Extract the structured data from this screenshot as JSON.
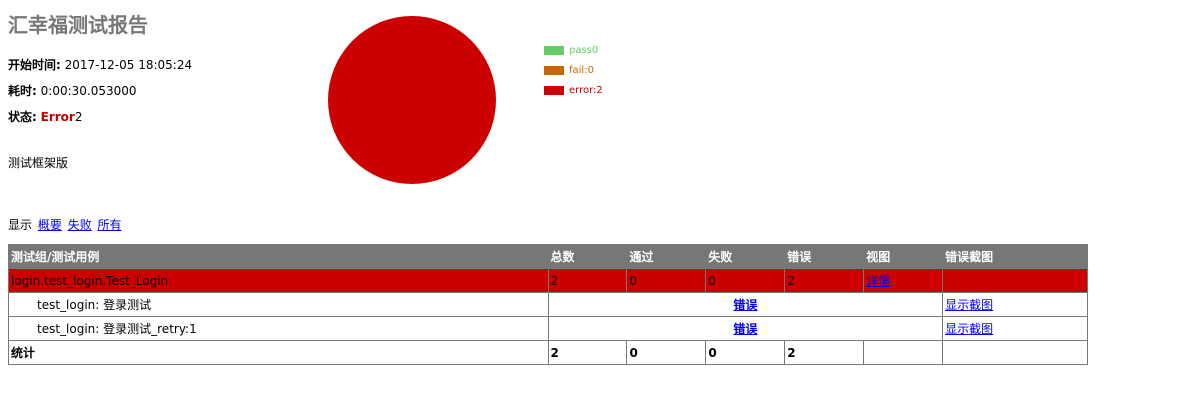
{
  "report": {
    "title": "汇幸福测试报告",
    "start_label": "开始时间:",
    "start_value": "2017-12-05 18:05:24",
    "duration_label": "耗时:",
    "duration_value": "0:00:30.053000",
    "status_label": "状态:",
    "status_value": "Error",
    "status_count": "2",
    "description": "测试框架版"
  },
  "chart_data": {
    "type": "pie",
    "slices": [
      {
        "name": "pass",
        "value": 0,
        "color": "#66cc66"
      },
      {
        "name": "fail",
        "value": 0,
        "color": "#cc6600"
      },
      {
        "name": "error",
        "value": 2,
        "color": "#cc0000"
      }
    ],
    "legend": [
      "pass0",
      "fail:0",
      "error:2"
    ],
    "legend_placement": "right"
  },
  "filter": {
    "label": "显示",
    "links": [
      "概要",
      "失败",
      "所有"
    ]
  },
  "table": {
    "headers": [
      "测试组/测试用例",
      "总数",
      "通过",
      "失败",
      "错误",
      "视图",
      "错误截图"
    ],
    "group_row": {
      "name": "login.test_login.Test_Login",
      "total": "2",
      "pass": "0",
      "fail": "0",
      "error": "2",
      "view": "详情",
      "screenshot": ""
    },
    "cases": [
      {
        "name": "test_login: 登录测试",
        "result": "错误",
        "screenshot": "显示截图"
      },
      {
        "name": "test_login: 登录测试_retry:1",
        "result": "错误",
        "screenshot": "显示截图"
      }
    ],
    "total_row": {
      "label": "统计",
      "total": "2",
      "pass": "0",
      "fail": "0",
      "error": "2",
      "view": "",
      "screenshot": ""
    }
  }
}
